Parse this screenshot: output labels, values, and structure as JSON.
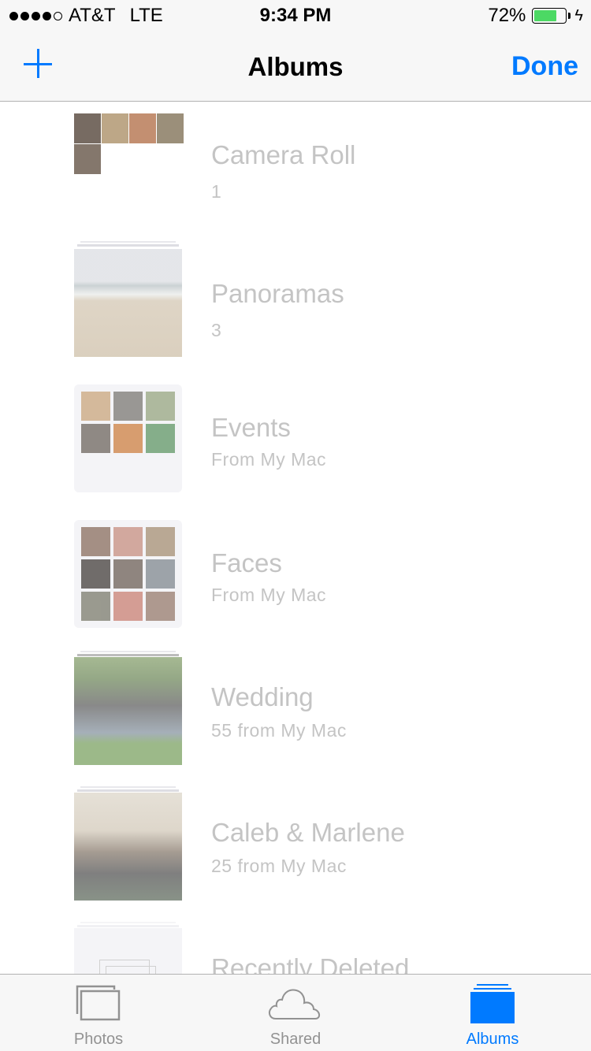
{
  "status_bar": {
    "signal_strength": 4,
    "signal_max": 5,
    "carrier": "AT&T",
    "network": "LTE",
    "time": "9:34 PM",
    "battery_percent_label": "72%",
    "battery_level": 0.72,
    "charging_icon": "bolt-icon",
    "battery_color": "#4cd964"
  },
  "nav_bar": {
    "add_icon": "plus-icon",
    "title": "Albums",
    "done_label": "Done",
    "accent_color": "#007aff"
  },
  "albums": [
    {
      "name": "Camera Roll",
      "subtitle": "1",
      "thumbnail": "photo-mosaic"
    },
    {
      "name": "Panoramas",
      "subtitle": "3",
      "thumbnail": "beach-photo"
    },
    {
      "name": "Events",
      "subtitle": "From My Mac",
      "thumbnail": "event-grid"
    },
    {
      "name": "Faces",
      "subtitle": "From My Mac",
      "thumbnail": "faces-grid"
    },
    {
      "name": "Wedding",
      "subtitle": "55 from My Mac",
      "thumbnail": "group-photo"
    },
    {
      "name": "Caleb & Marlene",
      "subtitle": "25 from My Mac",
      "thumbnail": "party-photo"
    },
    {
      "name": "Recently Deleted",
      "subtitle": "",
      "thumbnail": "empty-album"
    }
  ],
  "tab_bar": {
    "tabs": [
      {
        "label": "Photos",
        "icon": "photos-icon",
        "active": false
      },
      {
        "label": "Shared",
        "icon": "cloud-icon",
        "active": false
      },
      {
        "label": "Albums",
        "icon": "albums-icon",
        "active": true
      }
    ]
  }
}
